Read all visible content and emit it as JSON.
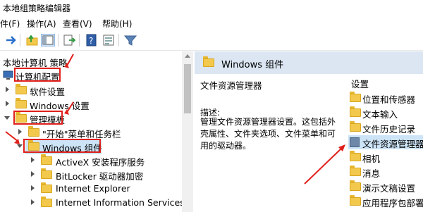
{
  "window": {
    "title": "本地组策略编辑器"
  },
  "menu": {
    "file": "件(F)",
    "action": "操作(A)",
    "view": "查看(V)",
    "help": "帮助(H)"
  },
  "tree": {
    "root": "本地计算机 策略",
    "computer_config": "计算机配置",
    "software_settings": "软件设置",
    "windows_settings": "Windows 设置",
    "admin_templates": "管理模板",
    "start_menu": "\"开始\"菜单和任务栏",
    "windows_components": "Windows 组件",
    "activex": "ActiveX 安装程序服务",
    "bitlocker": "BitLocker 驱动器加密",
    "ie": "Internet Explorer",
    "iis": "Internet Information Services"
  },
  "right": {
    "header": "Windows 组件",
    "selected_title": "文件资源管理器",
    "desc_label": "描述:",
    "desc_body": "管理文件资源管理器设置。这包括外壳属性、文件夹选项、文件菜单和可用的驱动器。",
    "list_header": "设置",
    "items": [
      "位置和传感器",
      "文本输入",
      "文件历史记录",
      "文件资源管理器",
      "相机",
      "消息",
      "演示文稿设置",
      "应用程序包部署"
    ]
  },
  "colors": {
    "accent": "#cde4f7",
    "annotation_red": "#e0201b",
    "header_bg": "#dbe6f2"
  }
}
